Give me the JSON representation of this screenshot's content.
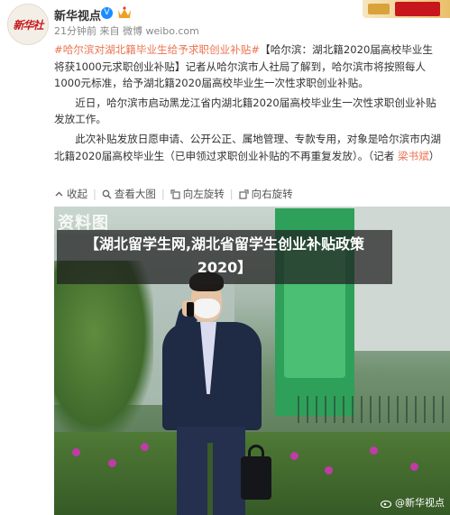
{
  "account": {
    "avatar_text": "新华社",
    "name": "新华视点",
    "verified_mark": "V",
    "meta": "21分钟前 来自 微博 weibo.com"
  },
  "post": {
    "topic": "#哈尔滨对湖北籍毕业生给予求职创业补贴#",
    "para1": "【哈尔滨：湖北籍2020届高校毕业生将获1000元求职创业补贴】记者从哈尔滨市人社局了解到，哈尔滨市将按照每人1000元标准，给予湖北籍2020届高校毕业生一次性求职创业补贴。",
    "para2": "近日，哈尔滨市启动黑龙江省内湖北籍2020届高校毕业生一次性求职创业补贴发放工作。",
    "para3_a": "此次补贴发放日愿申请、公开公正、属地管理、专款专用，对象是哈尔滨市内湖北籍2020届高校毕业生（已申领过求职创业补贴的不再重复发放）。（记者 ",
    "reporter": "梁书斌",
    "para3_b": "）"
  },
  "actions": {
    "collapse": "收起",
    "view_large": "查看大图",
    "rotate_left": "向左旋转",
    "rotate_right": "向右旋转"
  },
  "image": {
    "watermark_top": "资料图",
    "title": "【湖北留学生网,湖北省留学生创业补贴政策2020】",
    "watermark_bottom": "@新华视点"
  },
  "icons": [
    "verified-icon",
    "crown-icon",
    "collapse-icon",
    "zoom-icon",
    "rotate-left-icon",
    "rotate-right-icon",
    "weibo-icon"
  ]
}
